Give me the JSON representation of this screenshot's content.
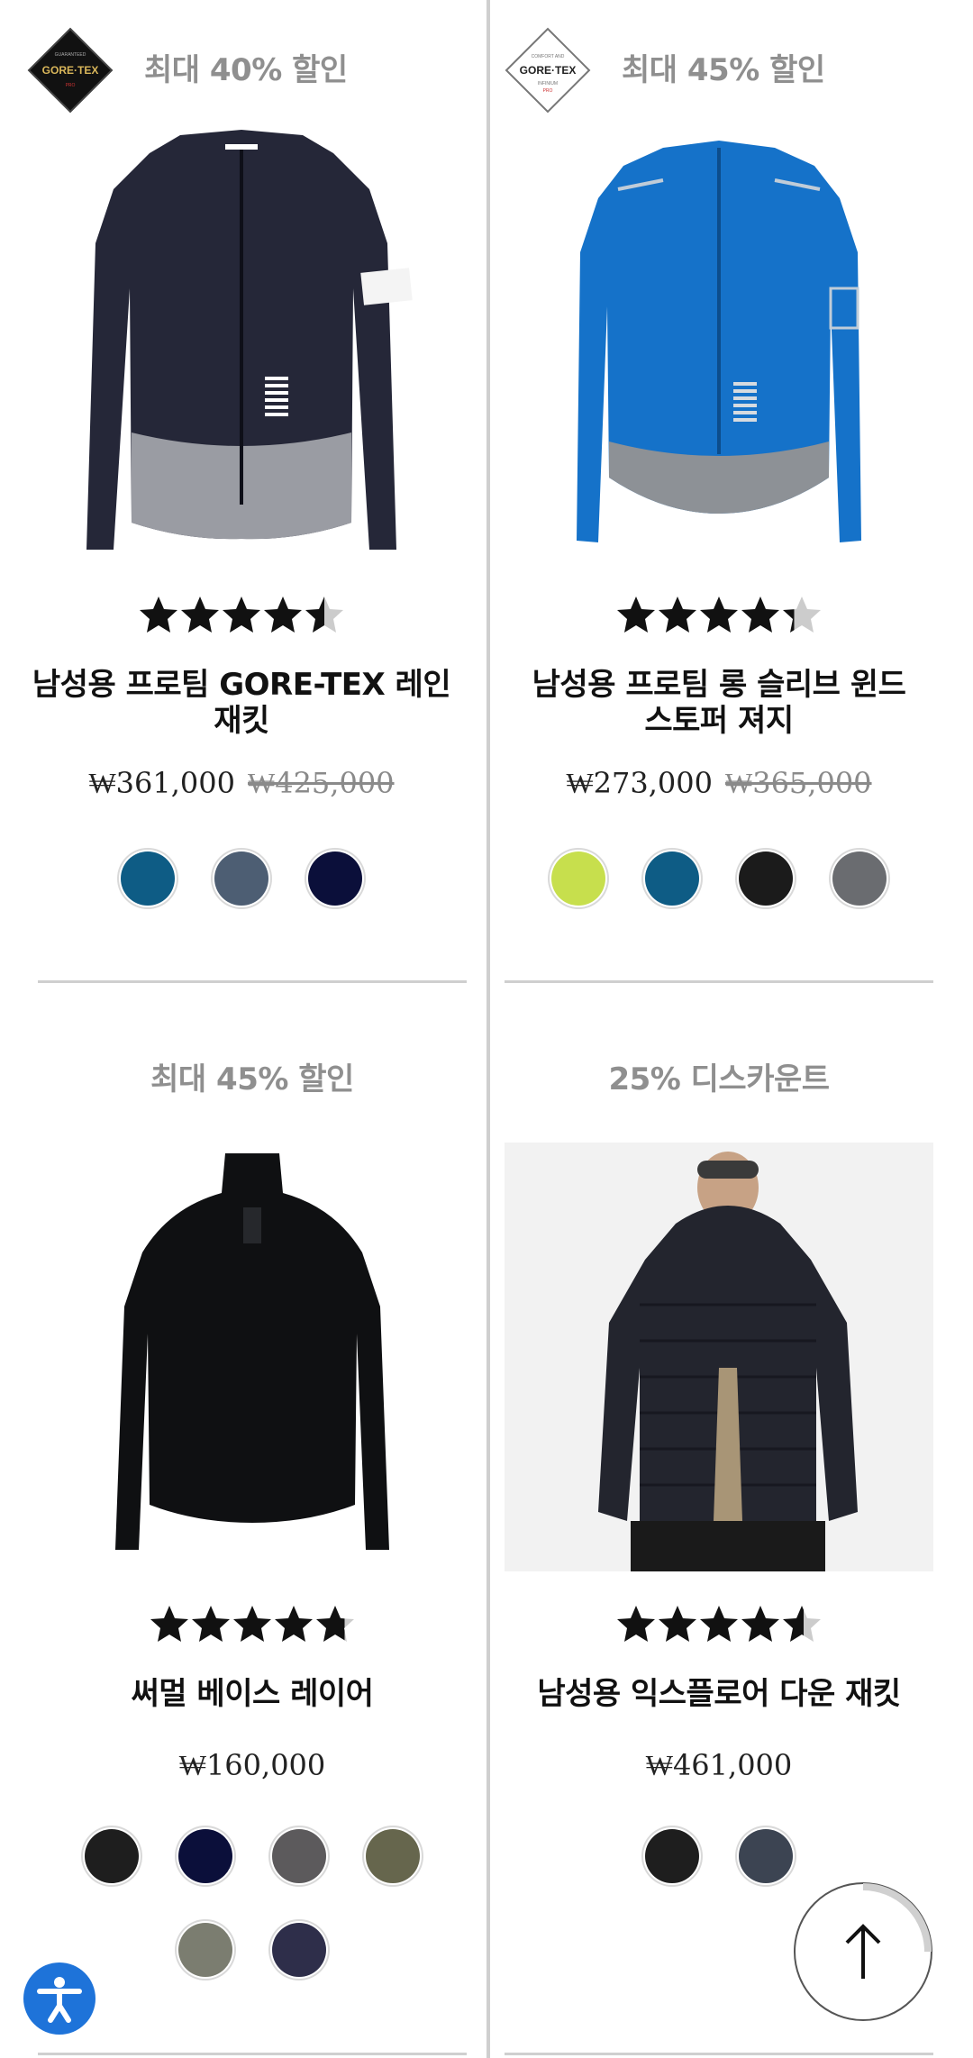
{
  "products": [
    {
      "promo": "최대 40% 할인",
      "badge": "gore-tex-black-badge",
      "rating": 4.5,
      "title_lines": [
        "남성용 프로팀 GORE-TEX 레인",
        "재킷"
      ],
      "price": "₩361,000",
      "original_price": "₩425,000",
      "swatches": [
        "#0e5c85",
        "#4d5e73",
        "#0b0f3a"
      ]
    },
    {
      "promo": "최대 45% 할인",
      "badge": "gore-tex-white-badge",
      "rating": 4.3,
      "title_lines": [
        "남성용 프로팀 롱 슬리브 윈드",
        "스토퍼 져지"
      ],
      "price": "₩273,000",
      "original_price": "₩365,000",
      "swatches": [
        "#c7df4d",
        "#0e5c85",
        "#1b1b1b",
        "#6a6c70"
      ]
    },
    {
      "promo": "최대 45% 할인",
      "rating": 4.8,
      "title_lines": [
        "써멀 베이스 레이어"
      ],
      "price": "₩160,000",
      "original_price": "",
      "swatches": [
        "#1e1e1e",
        "#0b0f3a",
        "#5c5a5c",
        "#66664d",
        "#7b7d70",
        "#2e2e4a"
      ]
    },
    {
      "promo": "25% 디스카운트",
      "rating": 4.6,
      "title_lines": [
        "남성용 익스플로어 다운 재킷"
      ],
      "price": "₩461,000",
      "original_price": "",
      "swatches": [
        "#1e1e1e",
        "#3c4452"
      ]
    }
  ],
  "icons": {
    "back_to_top": "arrow-up-icon",
    "accessibility": "accessibility-icon"
  },
  "colors": {
    "star": "#111111",
    "star_empty": "#cccccc",
    "promo_text": "#8f8f8f",
    "accessibility_bg": "#1e73d9"
  }
}
